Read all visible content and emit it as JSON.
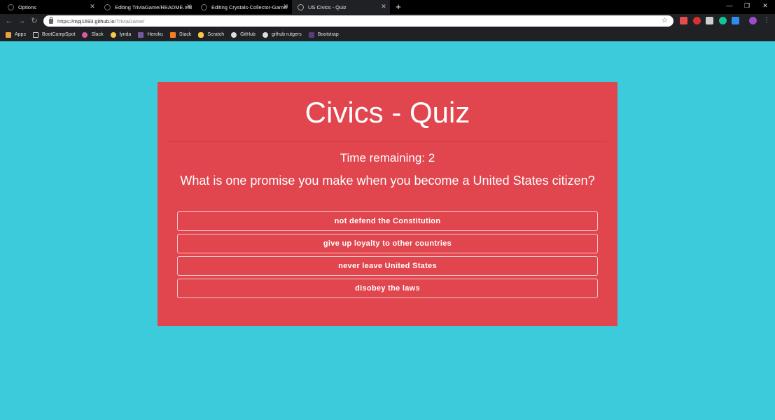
{
  "browser": {
    "tabs": [
      {
        "title": "Options",
        "active": false
      },
      {
        "title": "Editing TriviaGame/README.md",
        "active": false
      },
      {
        "title": "Editing Crystals-Collector-Game/",
        "active": false
      },
      {
        "title": "US Civics - Quiz",
        "active": true
      }
    ],
    "tab_close_glyph": "✕",
    "new_tab_glyph": "+",
    "window_controls": {
      "minimize": "—",
      "restore": "❐",
      "close": "✕"
    },
    "nav": {
      "back": "←",
      "forward": "→",
      "reload": "↻"
    },
    "url": {
      "scheme": "https://",
      "host": "mpj1693.github.io",
      "path": "/TriviaGame/"
    },
    "star_glyph": "☆",
    "menu_glyph": "⋮",
    "extensions": [
      {
        "name": "ext-red-arrow-icon",
        "color": "#e84b4b"
      },
      {
        "name": "ext-shield-icon",
        "color": "#d9302e"
      },
      {
        "name": "ext-box-icon",
        "color": "#cfcfcf"
      },
      {
        "name": "ext-grammarly-icon",
        "color": "#15c39a"
      },
      {
        "name": "ext-badge-icon",
        "color": "#2d8cf0"
      },
      {
        "name": "profile-avatar-icon",
        "color": "#9c4dcc"
      }
    ],
    "bookmarks": [
      {
        "label": "Apps",
        "icon": "apps-grid-icon",
        "color": "#e8a33d"
      },
      {
        "label": "BootCampSpot",
        "icon": "page-icon",
        "color": "#cfcfcf"
      },
      {
        "label": "Slack",
        "icon": "slack-icon",
        "color": "#d65aa8"
      },
      {
        "label": "lynda",
        "icon": "lynda-icon",
        "color": "#f2c94c"
      },
      {
        "label": "Heroku",
        "icon": "heroku-icon",
        "color": "#79589f"
      },
      {
        "label": "Stack",
        "icon": "stackoverflow-icon",
        "color": "#f48024"
      },
      {
        "label": "Scratch",
        "icon": "scratch-icon",
        "color": "#f6c744"
      },
      {
        "label": "GitHub",
        "icon": "github-icon",
        "color": "#dddddd"
      },
      {
        "label": "github rutgers",
        "icon": "github-icon",
        "color": "#dddddd"
      },
      {
        "label": "Bootstrap",
        "icon": "bootstrap-icon",
        "color": "#563d7c"
      }
    ]
  },
  "quiz": {
    "title": "Civics - Quiz",
    "timer_label": "Time remaining: 2",
    "question": "What is one promise you make when you become a United States citizen?",
    "answers": [
      "not defend the Constitution",
      "give up loyalty to other countries",
      "never leave United States",
      "disobey the laws"
    ]
  },
  "colors": {
    "page_background": "#3ccbdb",
    "card_background": "#e1454e",
    "text": "#ffffff"
  }
}
